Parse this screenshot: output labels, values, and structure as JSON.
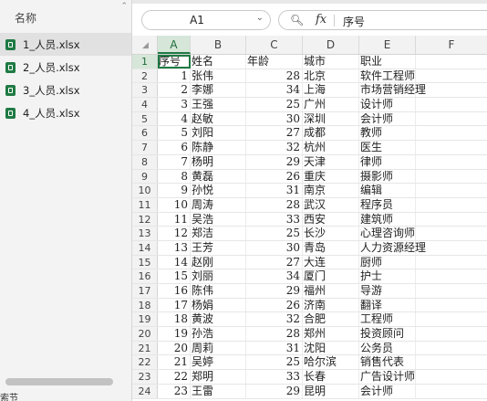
{
  "explorer": {
    "header_label": "名称",
    "files": [
      {
        "name": "1_人员.xlsx",
        "selected": true
      },
      {
        "name": "2_人员.xlsx",
        "selected": false
      },
      {
        "name": "3_人员.xlsx",
        "selected": false
      },
      {
        "name": "4_人员.xlsx",
        "selected": false
      }
    ],
    "footer_text": "索节"
  },
  "formula_bar": {
    "cell_ref": "A1",
    "fx_label": "fx",
    "value": "序号"
  },
  "columns": [
    "A",
    "B",
    "C",
    "D",
    "E",
    "F"
  ],
  "active_column": "A",
  "active_row": "1",
  "rows": [
    {
      "n": "1",
      "a": "序号",
      "b": "姓名",
      "c": "年龄",
      "d": "城市",
      "e": "职业",
      "header": true
    },
    {
      "n": "2",
      "a": "1",
      "b": "张伟",
      "c": "28",
      "d": "北京",
      "e": "软件工程师"
    },
    {
      "n": "3",
      "a": "2",
      "b": "李娜",
      "c": "34",
      "d": "上海",
      "e": "市场营销经理"
    },
    {
      "n": "4",
      "a": "3",
      "b": "王强",
      "c": "25",
      "d": "广州",
      "e": "设计师"
    },
    {
      "n": "5",
      "a": "4",
      "b": "赵敏",
      "c": "30",
      "d": "深圳",
      "e": "会计师"
    },
    {
      "n": "6",
      "a": "5",
      "b": "刘阳",
      "c": "27",
      "d": "成都",
      "e": "教师"
    },
    {
      "n": "7",
      "a": "6",
      "b": "陈静",
      "c": "32",
      "d": "杭州",
      "e": "医生"
    },
    {
      "n": "8",
      "a": "7",
      "b": "杨明",
      "c": "29",
      "d": "天津",
      "e": "律师"
    },
    {
      "n": "9",
      "a": "8",
      "b": "黄磊",
      "c": "26",
      "d": "重庆",
      "e": "摄影师"
    },
    {
      "n": "10",
      "a": "9",
      "b": "孙悦",
      "c": "31",
      "d": "南京",
      "e": "编辑"
    },
    {
      "n": "11",
      "a": "10",
      "b": "周涛",
      "c": "28",
      "d": "武汉",
      "e": "程序员"
    },
    {
      "n": "12",
      "a": "11",
      "b": "吴浩",
      "c": "33",
      "d": "西安",
      "e": "建筑师"
    },
    {
      "n": "13",
      "a": "12",
      "b": "郑洁",
      "c": "25",
      "d": "长沙",
      "e": "心理咨询师"
    },
    {
      "n": "14",
      "a": "13",
      "b": "王芳",
      "c": "30",
      "d": "青岛",
      "e": "人力资源经理"
    },
    {
      "n": "15",
      "a": "14",
      "b": "赵刚",
      "c": "27",
      "d": "大连",
      "e": "厨师"
    },
    {
      "n": "16",
      "a": "15",
      "b": "刘丽",
      "c": "34",
      "d": "厦门",
      "e": "护士"
    },
    {
      "n": "17",
      "a": "16",
      "b": "陈伟",
      "c": "29",
      "d": "福州",
      "e": "导游"
    },
    {
      "n": "18",
      "a": "17",
      "b": "杨娟",
      "c": "26",
      "d": "济南",
      "e": "翻译"
    },
    {
      "n": "19",
      "a": "18",
      "b": "黄波",
      "c": "32",
      "d": "合肥",
      "e": "工程师"
    },
    {
      "n": "20",
      "a": "19",
      "b": "孙浩",
      "c": "28",
      "d": "郑州",
      "e": "投资顾问"
    },
    {
      "n": "21",
      "a": "20",
      "b": "周莉",
      "c": "31",
      "d": "沈阳",
      "e": "公务员"
    },
    {
      "n": "22",
      "a": "21",
      "b": "吴婷",
      "c": "25",
      "d": "哈尔滨",
      "e": "销售代表"
    },
    {
      "n": "23",
      "a": "22",
      "b": "郑明",
      "c": "33",
      "d": "长春",
      "e": "广告设计师"
    },
    {
      "n": "24",
      "a": "23",
      "b": "王雷",
      "c": "29",
      "d": "昆明",
      "e": "会计师"
    }
  ],
  "colors": {
    "accent": "#1f7a44",
    "selected_header_bg": "#d6e7d9"
  }
}
